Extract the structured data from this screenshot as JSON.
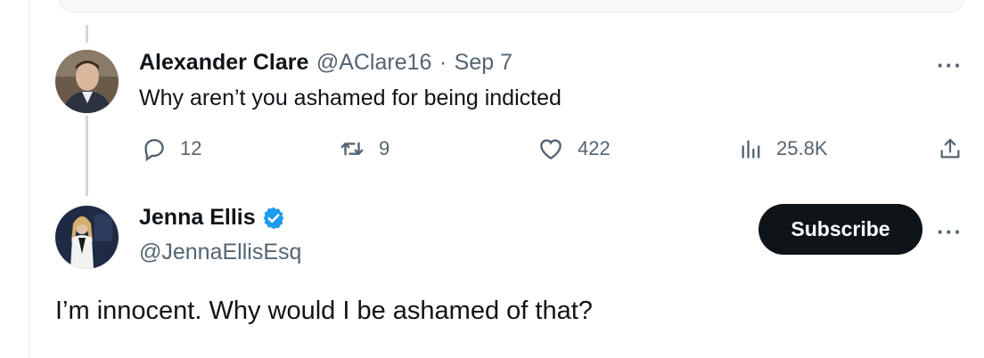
{
  "reply": {
    "author_name": "Alexander Clare",
    "author_handle": "@AClare16",
    "separator": "·",
    "date": "Sep 7",
    "text": "Why aren’t you ashamed for being indicted",
    "more_icon": "more-horizontal-icon",
    "actions": {
      "replies": "12",
      "retweets": "9",
      "likes": "422",
      "views": "25.8K"
    }
  },
  "main_tweet": {
    "author_name": "Jenna Ellis",
    "author_handle": "@JennaEllisEsq",
    "verified": true,
    "verified_color": "#1d9bf0",
    "subscribe_label": "Subscribe",
    "text": "I’m innocent. Why would I be ashamed of that?"
  },
  "colors": {
    "text_primary": "#0f1419",
    "text_secondary": "#536471",
    "thread_line": "#cfd9de",
    "button_bg": "#0f1419"
  }
}
